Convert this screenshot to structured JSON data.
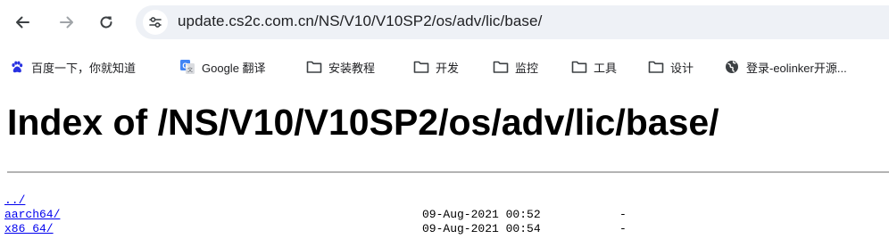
{
  "browser": {
    "url": "update.cs2c.com.cn/NS/V10/V10SP2/os/adv/lic/base/",
    "back_icon": "arrow-left-icon",
    "forward_icon": "arrow-right-icon",
    "reload_icon": "reload-icon",
    "site_info_icon": "tune-icon"
  },
  "bookmarks": [
    {
      "label": "百度一下，你就知道",
      "icon": "baidu-paw-icon"
    },
    {
      "label": "Google 翻译",
      "icon": "google-translate-icon"
    },
    {
      "label": "安装教程",
      "icon": "folder-icon"
    },
    {
      "label": "开发",
      "icon": "folder-icon"
    },
    {
      "label": "监控",
      "icon": "folder-icon"
    },
    {
      "label": "工具",
      "icon": "folder-icon"
    },
    {
      "label": "设计",
      "icon": "folder-icon"
    },
    {
      "label": "登录-eolinker开源...",
      "icon": "globe-icon"
    }
  ],
  "page": {
    "title": "Index of /NS/V10/V10SP2/os/adv/lic/base/",
    "entries": [
      {
        "name": "../",
        "date": "",
        "size": ""
      },
      {
        "name": "aarch64/",
        "date": "09-Aug-2021 00:52",
        "size": "-"
      },
      {
        "name": "x86_64/",
        "date": "09-Aug-2021 00:54",
        "size": "-"
      }
    ]
  },
  "colors": {
    "link": "#0000ee",
    "omnibox_bg": "#eef1f6",
    "rule": "#b4b4b4",
    "baidu_blue": "#2932e1"
  }
}
